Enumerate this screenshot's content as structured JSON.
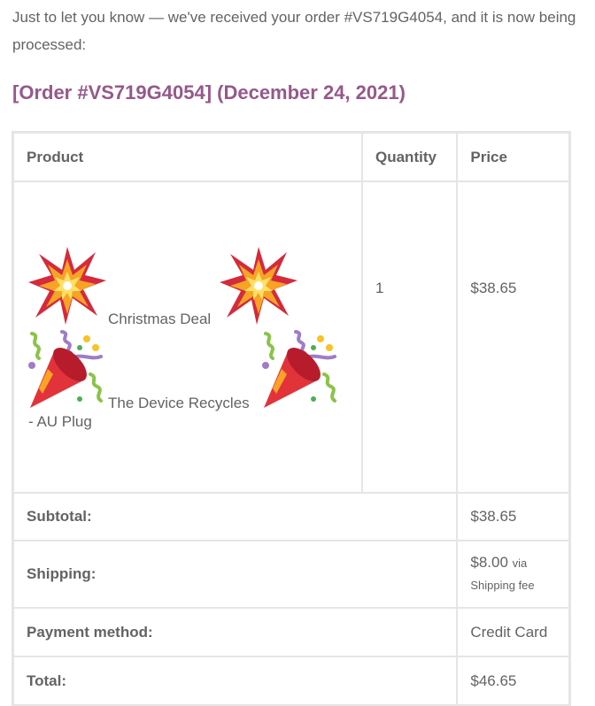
{
  "email": {
    "intro_text": "Just to let you know — we've received your order #VS719G4054, and it is now being processed:",
    "order_heading": "[Order #VS719G4054] (December 24, 2021)",
    "colors": {
      "heading": "#96588a",
      "text": "#636363",
      "border": "#e5e5e5"
    }
  },
  "table": {
    "headers": {
      "product": "Product",
      "quantity": "Quantity",
      "price": "Price"
    },
    "items": [
      {
        "deal_label": "Christmas Deal",
        "name_part1": "The Device Recycles",
        "name_part2": "- AU Plug",
        "quantity": "1",
        "price": "$38.65",
        "icons": [
          "collision-icon",
          "party-popper-icon"
        ]
      }
    ],
    "totals": {
      "subtotal_label": "Subtotal:",
      "subtotal_value": "$38.65",
      "shipping_label": "Shipping:",
      "shipping_value": "$8.00",
      "shipping_via": "via",
      "shipping_method": "Shipping fee",
      "payment_label": "Payment method:",
      "payment_value": "Credit Card",
      "total_label": "Total:",
      "total_value": "$46.65"
    }
  }
}
